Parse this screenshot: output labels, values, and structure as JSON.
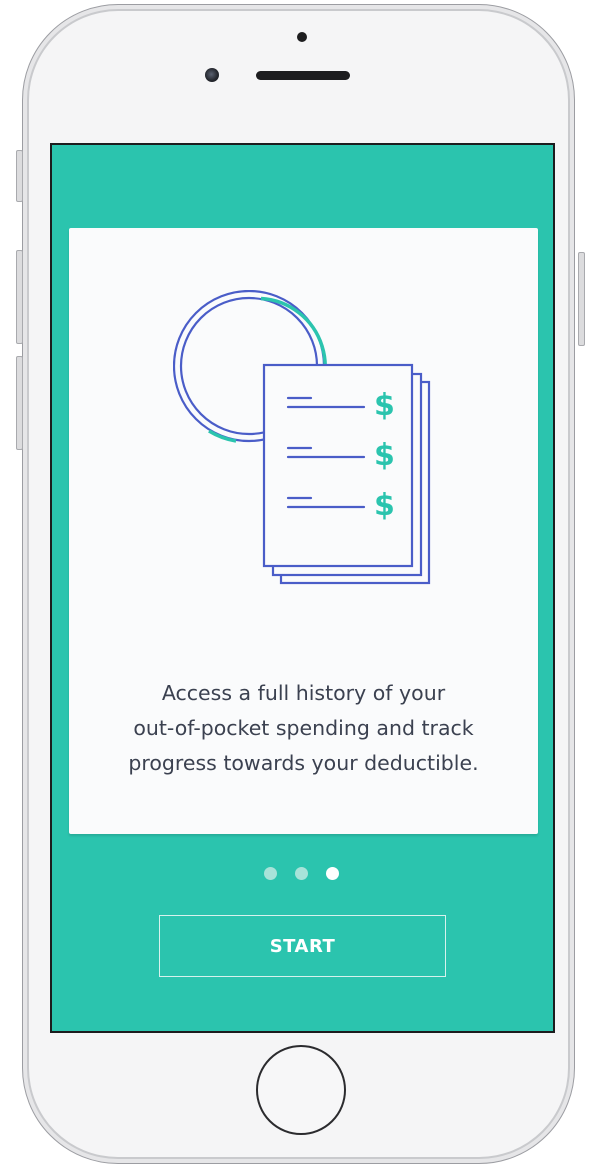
{
  "onboarding": {
    "description_lines": [
      "Access a full history of your",
      "out-of-pocket spending and track",
      "progress towards your deductible."
    ],
    "illustration": {
      "currency_symbol": "$",
      "icon": "receipt-history-icon"
    },
    "pagination": {
      "total": 3,
      "active_index": 2
    },
    "start_button_label": "START"
  },
  "colors": {
    "screen_background": "#2bc4ae",
    "card_background": "#fafbfc",
    "illustration_blue": "#4a5dc8",
    "illustration_teal": "#2bc4ae",
    "text": "#3b4150"
  }
}
